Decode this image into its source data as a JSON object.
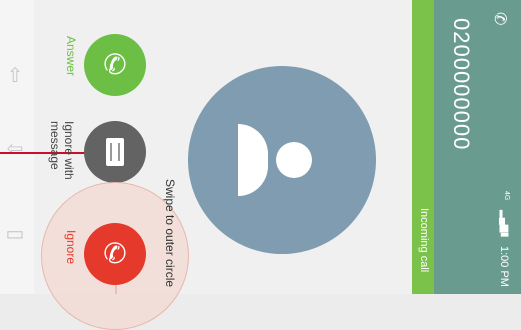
{
  "caller": {
    "number": "0200000000"
  },
  "call_status": "Incoming call",
  "status_bar": {
    "time": "1:00 PM",
    "network": "4G"
  },
  "actions": {
    "answer_label": "Answer",
    "message_label_line1": "Ignore with",
    "message_label_line2": "message",
    "ignore_label": "Ignore"
  },
  "hint": "Swipe to outer circle",
  "colors": {
    "header": "#6a9b8f",
    "status_strip": "#7bc24a",
    "answer": "#6cbf44",
    "ignore": "#e53a2b",
    "message": "#636363",
    "avatar": "#7f9cb0"
  }
}
